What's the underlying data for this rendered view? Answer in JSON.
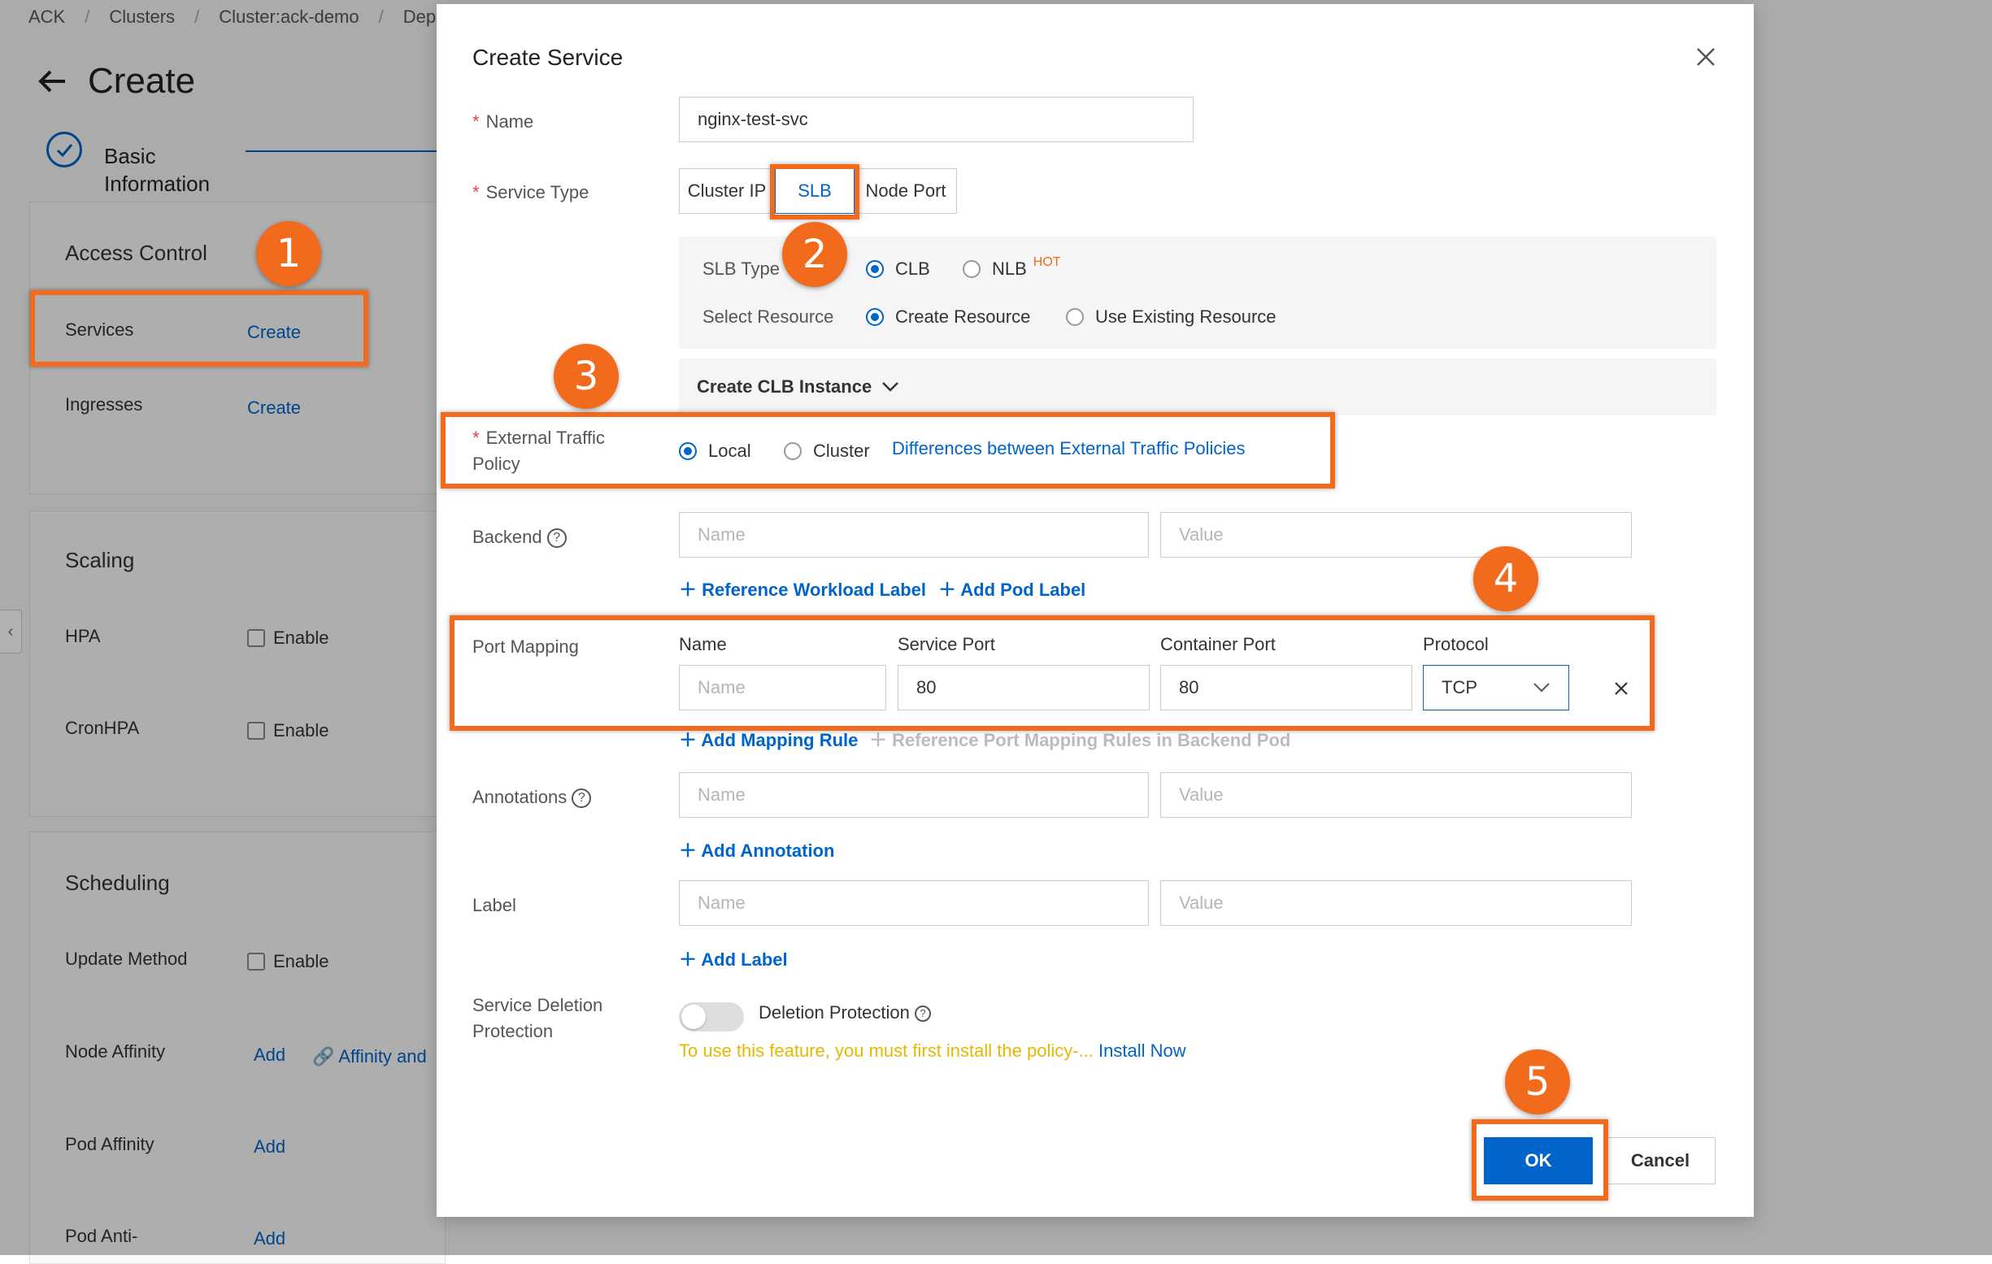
{
  "breadcrumb": [
    "ACK",
    "Clusters",
    "Cluster:ack-demo",
    "Dep"
  ],
  "page": {
    "title": "Create",
    "step_label_1": "Basic",
    "step_label_2": "Information"
  },
  "bg": {
    "access_control": "Access Control",
    "services_label": "Services",
    "services_link": "Create",
    "ingresses_label": "Ingresses",
    "ingresses_link": "Create",
    "scaling": "Scaling",
    "hpa": "HPA",
    "cronhpa": "CronHPA",
    "enable": "Enable",
    "scheduling": "Scheduling",
    "update_method": "Update Method",
    "node_affinity": "Node Affinity",
    "add": "Add",
    "affinity_link": "Affinity and",
    "pod_affinity": "Pod Affinity",
    "pod_anti": "Pod Anti-"
  },
  "modal": {
    "title": "Create Service",
    "name_label": "Name",
    "name_value": "nginx-test-svc",
    "service_type_label": "Service Type",
    "service_types": [
      "Cluster IP",
      "SLB",
      "Node Port"
    ],
    "slb_type_label": "SLB Type",
    "clb": "CLB",
    "nlb": "NLB",
    "hot": "HOT",
    "select_resource_label": "Select Resource",
    "create_resource": "Create Resource",
    "use_existing": "Use Existing Resource",
    "create_clb": "Create CLB Instance",
    "etp_label_1": "External Traffic",
    "etp_label_2": "Policy",
    "local": "Local",
    "cluster": "Cluster",
    "etp_link": "Differences between External Traffic Policies",
    "backend_label": "Backend",
    "placeholder_name": "Name",
    "placeholder_value": "Value",
    "ref_workload": "Reference Workload Label",
    "add_pod_label": "Add Pod Label",
    "port_mapping_label": "Port Mapping",
    "col_name": "Name",
    "col_service_port": "Service Port",
    "col_container_port": "Container Port",
    "col_protocol": "Protocol",
    "service_port": "80",
    "container_port": "80",
    "protocol": "TCP",
    "add_mapping": "Add Mapping Rule",
    "ref_port_mapping": "Reference Port Mapping Rules in Backend Pod",
    "annotations_label": "Annotations",
    "add_annotation": "Add Annotation",
    "label_label": "Label",
    "add_label": "Add Label",
    "sdp_label_1": "Service Deletion",
    "sdp_label_2": "Protection",
    "deletion_protection": "Deletion Protection",
    "policy_warning": "To use this feature, you must first install the policy-...",
    "install_now": "Install Now",
    "ok": "OK",
    "cancel": "Cancel"
  },
  "badges": [
    "1",
    "2",
    "3",
    "4",
    "5"
  ],
  "colors": {
    "accent": "#0064c8",
    "highlight": "#f26a1b",
    "required": "#e5453a",
    "warning": "#e6b800"
  }
}
